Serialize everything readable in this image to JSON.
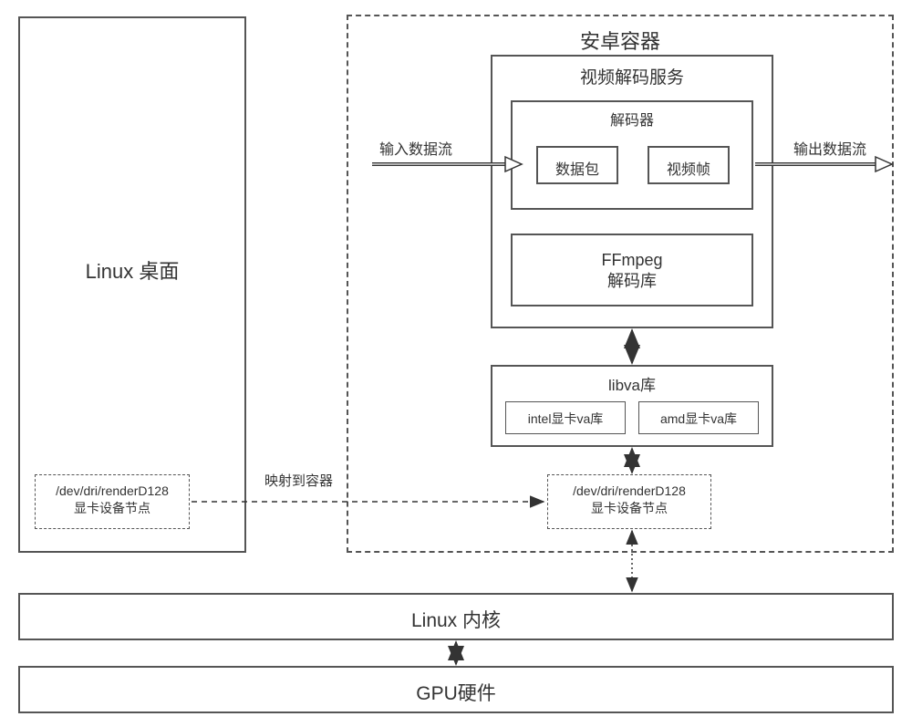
{
  "linux_desktop": {
    "title": "Linux 桌面",
    "dev_node": {
      "path": "/dev/dri/renderD128",
      "desc": "显卡设备节点"
    }
  },
  "mapping_label": "映射到容器",
  "android_container": {
    "title": "安卓容器",
    "video_service": {
      "title": "视频解码服务",
      "decoder": {
        "title": "解码器",
        "packet": "数据包",
        "frame": "视频帧"
      },
      "ffmpeg": {
        "name": "FFmpeg",
        "desc": "解码库"
      }
    },
    "io": {
      "input": "输入数据流",
      "output": "输出数据流"
    },
    "libva": {
      "title": "libva库",
      "intel": "intel显卡va库",
      "amd": "amd显卡va库"
    },
    "dev_node": {
      "path": "/dev/dri/renderD128",
      "desc": "显卡设备节点"
    }
  },
  "stack": {
    "kernel": "Linux 内核",
    "gpu": "GPU硬件"
  }
}
